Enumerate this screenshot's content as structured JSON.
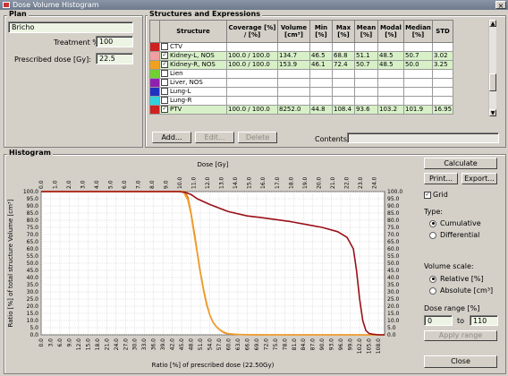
{
  "window": {
    "title": "Dose Volume Histogram",
    "close_glyph": "×"
  },
  "plan": {
    "section_label": "Plan",
    "name_value": "Bricho",
    "treatment_label": "Treatment %:",
    "treatment_value": "100",
    "dose_label": "Prescribed dose [Gy]:",
    "dose_value": "22.5"
  },
  "structures": {
    "section_label": "Structures and Expressions",
    "columns": [
      "",
      "Structure",
      "Coverage [%] / [%]",
      "Volume [cm³]",
      "Min [%]",
      "Max [%]",
      "Mean [%]",
      "Modal [%]",
      "Median [%]",
      "STD"
    ],
    "rows": [
      {
        "color": "#cc2222",
        "checked": false,
        "name": "CTV",
        "coverage": "",
        "volume": "",
        "min": "",
        "max": "",
        "mean": "",
        "modal": "",
        "median": "",
        "std": ""
      },
      {
        "color": "#f0a0a0",
        "checked": true,
        "name": "Kidney-L, NOS",
        "coverage": "100.0 / 100.0",
        "volume": "134.7",
        "min": "46.5",
        "max": "68.8",
        "mean": "51.1",
        "modal": "48.5",
        "median": "50.7",
        "std": "3.02"
      },
      {
        "color": "#f0a020",
        "checked": true,
        "name": "Kidney-R, NOS",
        "coverage": "100.0 / 100.0",
        "volume": "153.9",
        "min": "46.1",
        "max": "72.4",
        "mean": "50.7",
        "modal": "48.5",
        "median": "50.0",
        "std": "3.25"
      },
      {
        "color": "#70d030",
        "checked": false,
        "name": "Lien",
        "coverage": "",
        "volume": "",
        "min": "",
        "max": "",
        "mean": "",
        "modal": "",
        "median": "",
        "std": ""
      },
      {
        "color": "#9020b0",
        "checked": false,
        "name": "Liver, NOS",
        "coverage": "",
        "volume": "",
        "min": "",
        "max": "",
        "mean": "",
        "modal": "",
        "median": "",
        "std": ""
      },
      {
        "color": "#2030c0",
        "checked": false,
        "name": "Lung-L",
        "coverage": "",
        "volume": "",
        "min": "",
        "max": "",
        "mean": "",
        "modal": "",
        "median": "",
        "std": ""
      },
      {
        "color": "#30d0e0",
        "checked": false,
        "name": "Lung-R",
        "coverage": "",
        "volume": "",
        "min": "",
        "max": "",
        "mean": "",
        "modal": "",
        "median": "",
        "std": ""
      },
      {
        "color": "#cc2222",
        "checked": true,
        "name": "PTV",
        "coverage": "100.0 / 100.0",
        "volume": "8252.0",
        "min": "44.8",
        "max": "108.4",
        "mean": "93.6",
        "modal": "103.2",
        "median": "101.9",
        "std": "16.95"
      }
    ],
    "add_label": "Add...",
    "edit_label": "Edit...",
    "delete_label": "Delete",
    "contents_label": "Contents:",
    "contents_value": ""
  },
  "histogram": {
    "section_label": "Histogram"
  },
  "side": {
    "calculate_label": "Calculate",
    "print_label": "Print...",
    "export_label": "Export...",
    "grid_label": "Grid",
    "grid_checked": true,
    "type_label": "Type:",
    "cumulative_label": "Cumulative",
    "differential_label": "Differential",
    "type_selected": "Cumulative",
    "volume_scale_label": "Volume scale:",
    "relative_label": "Relative [%]",
    "absolute_label": "Absolute [cm³]",
    "volume_selected": "Relative [%]",
    "dose_range_label": "Dose range [%]",
    "range_from": "0",
    "range_to_label": "to",
    "range_to": "110",
    "apply_label": "Apply range",
    "close_label": "Close"
  },
  "chart_data": {
    "type": "line",
    "title": "",
    "top_axis_label": "Dose [Gy]",
    "xlabel": "Ratio [%] of prescribed dose (22.50Gy)",
    "ylabel": "Ratio [%] of total structure Volume [cm³]",
    "xlim": [
      0,
      110
    ],
    "ylim": [
      0,
      100
    ],
    "grid": true,
    "x_ticks": [
      "0.0",
      "3.0",
      "6.0",
      "9.0",
      "12.0",
      "15.0",
      "18.0",
      "21.0",
      "24.0",
      "27.0",
      "30.0",
      "33.0",
      "36.0",
      "39.0",
      "42.0",
      "45.0",
      "48.0",
      "51.0",
      "54.0",
      "57.0",
      "60.0",
      "63.0",
      "66.0",
      "69.0",
      "72.0",
      "75.0",
      "78.0",
      "81.0",
      "84.0",
      "87.0",
      "90.0",
      "93.0",
      "96.0",
      "99.0",
      "102.0",
      "105.0",
      "108.0"
    ],
    "top_ticks": [
      "0.0",
      "1.0",
      "2.0",
      "3.0",
      "4.0",
      "5.0",
      "6.0",
      "7.0",
      "8.0",
      "9.0",
      "10.0",
      "11.0",
      "12.0",
      "13.0",
      "14.0",
      "15.0",
      "16.0",
      "17.0",
      "18.0",
      "19.0",
      "20.0",
      "21.0",
      "22.0",
      "23.0",
      "24.0"
    ],
    "y_ticks": [
      "0.0",
      "5.0",
      "10.0",
      "15.0",
      "20.0",
      "25.0",
      "30.0",
      "35.0",
      "40.0",
      "45.0",
      "50.0",
      "55.0",
      "60.0",
      "65.0",
      "70.0",
      "75.0",
      "80.0",
      "85.0",
      "90.0",
      "95.0",
      "100.0"
    ],
    "series": [
      {
        "name": "Kidney-L, NOS",
        "color": "#e07a10",
        "x": [
          0,
          46,
          47,
          48,
          49,
          50,
          51,
          52,
          53,
          54,
          55,
          56,
          57,
          58,
          59,
          60,
          62,
          65,
          69,
          110
        ],
        "y": [
          100,
          100,
          96,
          85,
          72,
          58,
          44,
          32,
          22,
          14,
          9,
          6,
          3.8,
          2.2,
          1.2,
          0.7,
          0.3,
          0.1,
          0,
          0
        ]
      },
      {
        "name": "Kidney-R, NOS",
        "color": "#f0a030",
        "x": [
          0,
          45.5,
          47,
          48,
          49,
          50,
          51,
          52,
          53,
          54,
          55,
          56,
          57,
          58,
          59,
          60,
          63,
          66,
          72,
          110
        ],
        "y": [
          100,
          100,
          94,
          84,
          70,
          57,
          43,
          31,
          21,
          14,
          9,
          6,
          4,
          2.5,
          1.5,
          0.8,
          0.3,
          0.1,
          0,
          0
        ]
      },
      {
        "name": "PTV",
        "color": "#9a1018",
        "x": [
          0,
          44,
          46,
          48,
          50,
          54,
          60,
          66,
          70,
          75,
          80,
          85,
          90,
          95,
          98,
          100,
          101,
          102,
          103,
          104,
          105,
          106,
          108,
          110
        ],
        "y": [
          100,
          100,
          99.5,
          98,
          95,
          91,
          86,
          83,
          82,
          80.5,
          79,
          77,
          75,
          72,
          68,
          60,
          45,
          25,
          10,
          3,
          1,
          0.5,
          0,
          0
        ]
      }
    ]
  }
}
